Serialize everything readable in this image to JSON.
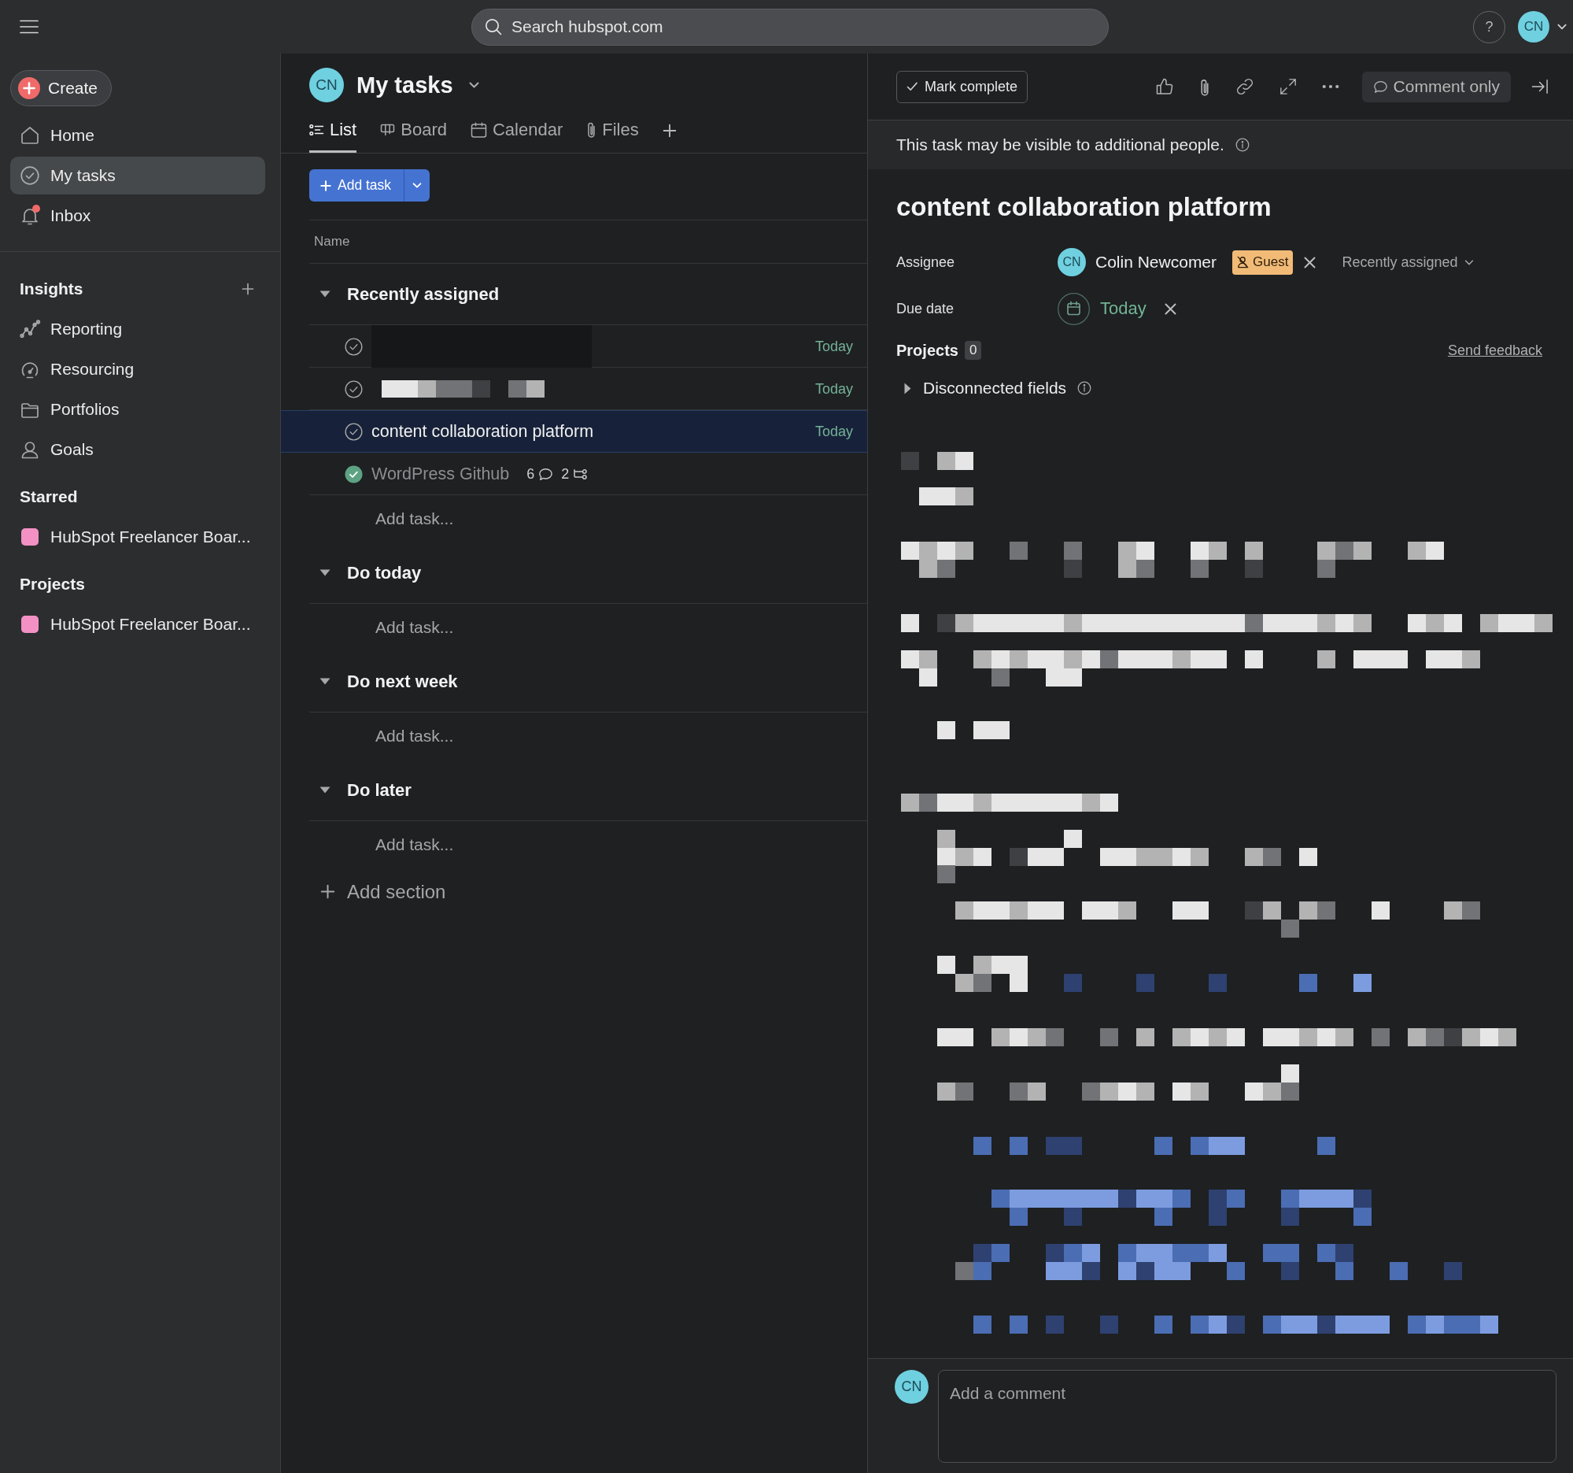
{
  "topbar": {
    "search": {
      "placeholder": "Search hubspot.com"
    },
    "help": "?",
    "avatar": "CN"
  },
  "sidebar": {
    "create": "Create",
    "nav": [
      {
        "label": "Home",
        "selected": false,
        "unread": false
      },
      {
        "label": "My tasks",
        "selected": true,
        "unread": false
      },
      {
        "label": "Inbox",
        "selected": false,
        "unread": true
      }
    ],
    "sections": [
      {
        "title": "Insights",
        "can_add": true,
        "items": [
          {
            "kind": "insight",
            "label": "Reporting"
          },
          {
            "kind": "insight",
            "label": "Resourcing"
          },
          {
            "kind": "insight",
            "label": "Portfolios"
          },
          {
            "kind": "insight",
            "label": "Goals"
          }
        ]
      },
      {
        "title": "Starred",
        "can_add": false,
        "items": [
          {
            "kind": "project",
            "label": "HubSpot Freelancer Boar...",
            "color": "#f391c4"
          }
        ]
      },
      {
        "title": "Projects",
        "can_add": false,
        "items": [
          {
            "kind": "project",
            "label": "HubSpot Freelancer Boar...",
            "color": "#f391c4"
          }
        ]
      }
    ]
  },
  "page": {
    "avatar": "CN",
    "title": "My tasks",
    "tabs": [
      {
        "label": "List",
        "selected": true
      },
      {
        "label": "Board",
        "selected": false
      },
      {
        "label": "Calendar",
        "selected": false
      },
      {
        "label": "Files",
        "selected": false
      }
    ],
    "add_task": "Add task",
    "column": "Name",
    "sections": [
      {
        "title": "Recently assigned",
        "expanded": true,
        "tasks": [
          {
            "kind": "redacted",
            "due": "Today",
            "completed": false,
            "selected": false
          },
          {
            "kind": "pixelated",
            "due": "Today",
            "completed": false,
            "selected": false
          },
          {
            "kind": "named",
            "name": "content collaboration platform",
            "due": "Today",
            "completed": false,
            "selected": true
          },
          {
            "kind": "named",
            "name": "WordPress Github",
            "completed": true,
            "selected": false,
            "comments": "6",
            "subtasks": "2"
          }
        ],
        "add_task": "Add task..."
      },
      {
        "title": "Do today",
        "expanded": true,
        "add_task": "Add task..."
      },
      {
        "title": "Do next week",
        "expanded": true,
        "add_task": "Add task..."
      },
      {
        "title": "Do later",
        "expanded": true,
        "add_task": "Add task..."
      }
    ],
    "add_section": "Add section"
  },
  "detail": {
    "mark_complete": "Mark complete",
    "comment_only": "Comment only",
    "notice": "This task may be visible to additional people.",
    "title": "content collaboration platform",
    "assignee": {
      "label": "Assignee",
      "avatar": "CN",
      "name": "Colin Newcomer",
      "badge": "Guest",
      "section": "Recently assigned"
    },
    "due_date": {
      "label": "Due date",
      "value": "Today"
    },
    "projects": {
      "label": "Projects",
      "count": "0",
      "feedback": "Send feedback"
    },
    "disconnected_fields": {
      "label": "Disconnected fields",
      "expanded": false
    },
    "comment": {
      "avatar": "CN",
      "placeholder": "Add a comment"
    }
  }
}
